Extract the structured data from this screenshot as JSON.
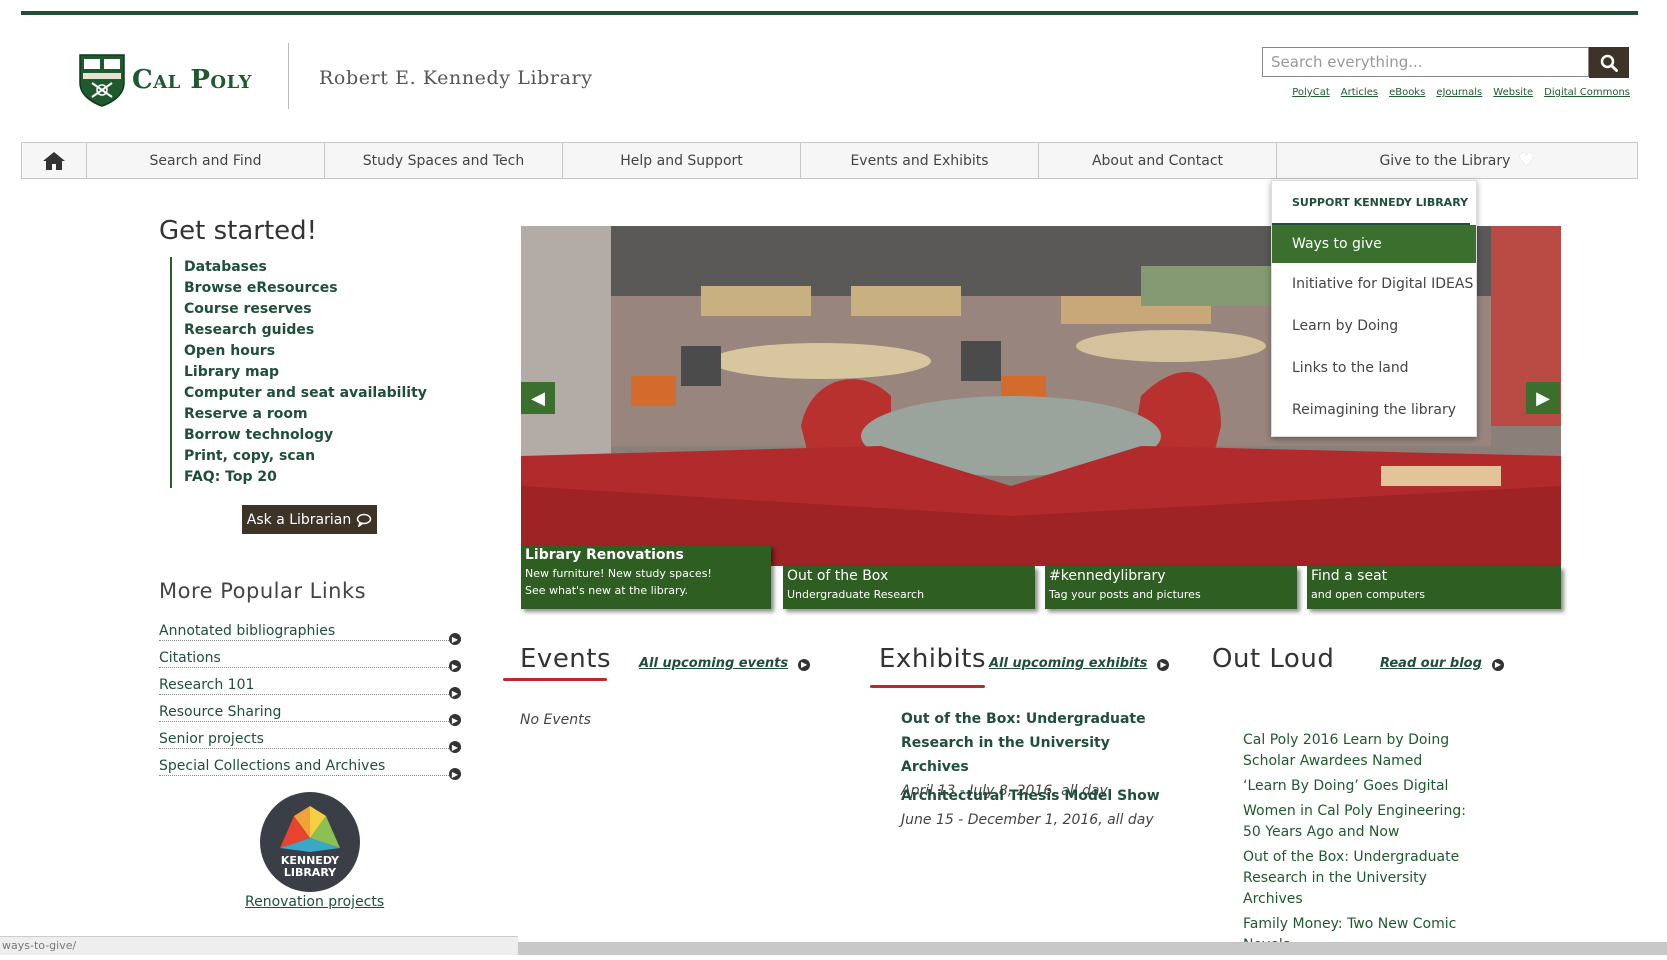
{
  "header": {
    "logo_text": "Cal Poly",
    "library_name": "Robert E. Kennedy Library",
    "search_placeholder": "Search everything...",
    "search_links": [
      "PolyCat",
      "Articles",
      "eBooks",
      "eJournals",
      "Website",
      "Digital Commons"
    ]
  },
  "nav": {
    "items": [
      "Search and Find",
      "Study Spaces and Tech",
      "Help and Support",
      "Events and Exhibits",
      "About and Contact",
      "Give to the Library"
    ]
  },
  "dropdown": {
    "heading": "SUPPORT KENNEDY LIBRARY",
    "items": [
      "Ways to give",
      "Initiative for Digital IDEAS",
      "Learn by Doing",
      "Links to the land",
      "Reimagining the library"
    ]
  },
  "get_started": {
    "title": "Get started!",
    "links": [
      "Databases",
      "Browse eResources",
      "Course reserves",
      "Research guides",
      "Open hours",
      "Library map",
      "Computer and seat availability",
      "Reserve a room",
      "Borrow technology",
      "Print, copy, scan",
      "FAQ: Top 20"
    ],
    "ask_button": "Ask a Librarian"
  },
  "popular": {
    "title": "More Popular Links",
    "links": [
      "Annotated bibliographies",
      "Citations",
      "Research 101",
      "Resource Sharing",
      "Senior projects",
      "Special Collections and Archives"
    ]
  },
  "badge": {
    "line1": "KENNEDY",
    "line2": "LIBRARY",
    "link": "Renovation projects"
  },
  "carousel": {
    "captions": [
      {
        "title": "Library Renovations",
        "sub1": "New furniture! New study spaces!",
        "sub2": "See what's new at the library."
      },
      {
        "title": "Out of the Box",
        "sub1": "Undergraduate Research"
      },
      {
        "title": "#kennedylibrary",
        "sub1": "Tag your posts and pictures"
      },
      {
        "title": "Find a seat",
        "sub1": "and open computers"
      }
    ]
  },
  "events": {
    "title": "Events",
    "link": "All upcoming events",
    "empty": "No Events"
  },
  "exhibits": {
    "title": "Exhibits",
    "link": "All upcoming exhibits",
    "items": [
      {
        "title": "Out of the Box: Undergraduate Research in the University Archives",
        "date": "April 13 - July 8, 2016, all day"
      },
      {
        "title": "Architectural Thesis Model Show",
        "date": "June 15 - December 1, 2016, all day"
      }
    ]
  },
  "outloud": {
    "title": "Out Loud",
    "link": "Read our blog",
    "posts": [
      "Cal Poly 2016 Learn by Doing Scholar Awardees Named",
      "‘Learn By Doing’ Goes Digital",
      "Women in Cal Poly Engineering: 50 Years Ago and Now",
      "Out of the Box: Undergraduate Research in the University Archives",
      "Family Money: Two New Comic Novels"
    ]
  },
  "status_bar": "ways-to-give/",
  "colors": {
    "brand_green": "#1f4f3a",
    "accent_green": "#3b6f2e",
    "accent_red": "#c0262d",
    "dark_brown": "#3d3326"
  }
}
